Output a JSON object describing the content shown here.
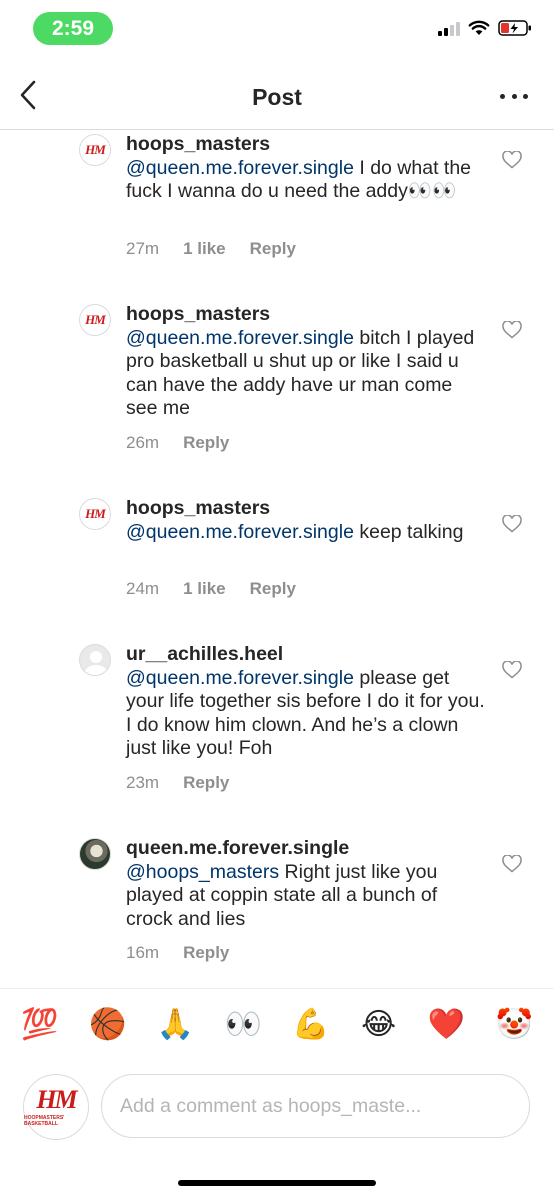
{
  "status_bar": {
    "time": "2:59"
  },
  "nav": {
    "title": "Post"
  },
  "comments": [
    {
      "username": "hoops_masters",
      "mention": "@queen.me.forever.single",
      "text": " I do what the fuck I wanna do u need the addy👀👀",
      "time": "27m",
      "likes": "1 like",
      "reply": "Reply"
    },
    {
      "username": "hoops_masters",
      "mention": "@queen.me.forever.single",
      "text": " bitch I played pro basketball u shut up or like I said u can have the addy have ur man come see me",
      "time": "26m",
      "likes": "",
      "reply": "Reply"
    },
    {
      "username": "hoops_masters",
      "mention": "@queen.me.forever.single",
      "text": " keep talking",
      "time": "24m",
      "likes": "1 like",
      "reply": "Reply"
    },
    {
      "username": "ur__achilles.heel",
      "mention": "@queen.me.forever.single",
      "text": " please get your life together sis before I do it for you. I do know him clown. And he’s a clown just like you! Foh",
      "time": "23m",
      "likes": "",
      "reply": "Reply"
    },
    {
      "username": "queen.me.forever.single",
      "mention": "@hoops_masters",
      "text": " Right just like you played at coppin state all a bunch of crock and lies",
      "time": "16m",
      "likes": "",
      "reply": "Reply"
    }
  ],
  "avatar_logo": {
    "mark": "HM",
    "tagline": "HOOPMASTERS' BASKETBALL"
  },
  "emoji_bar": [
    "💯",
    "🏀",
    "🙏",
    "👀",
    "💪",
    "😂",
    "❤️",
    "🤡"
  ],
  "composer": {
    "placeholder": "Add a comment as hoops_maste..."
  },
  "colors": {
    "time_pill": "#4cd964",
    "mention": "#003569",
    "meta": "#8e8e8e",
    "logo_red": "#cc1b1b"
  }
}
